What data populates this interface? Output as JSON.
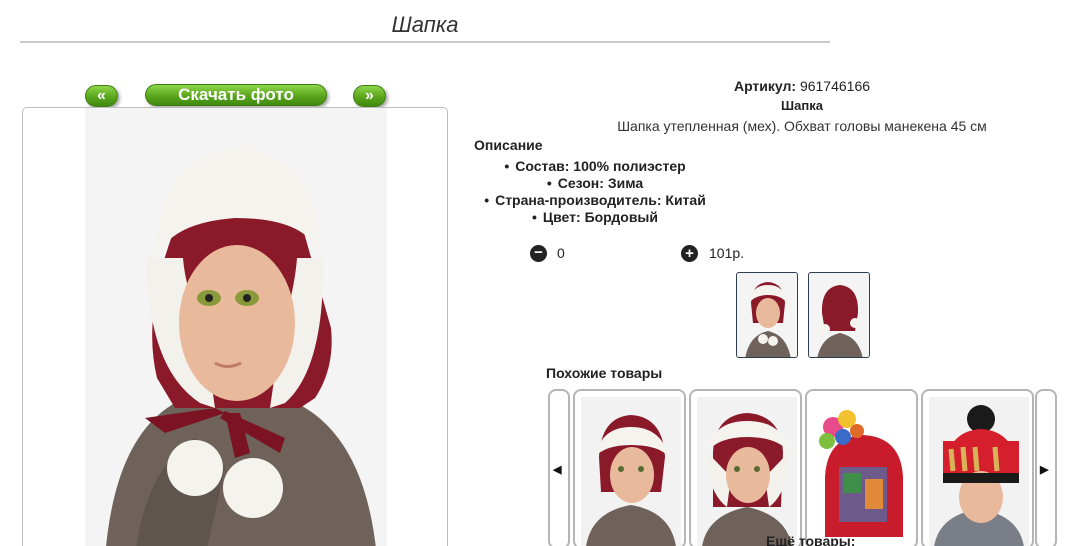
{
  "page": {
    "title": "Шапка"
  },
  "gallery": {
    "prev_label": "«",
    "download_label": "Скачать фото",
    "next_label": "»"
  },
  "product": {
    "sku_label": "Артикул:",
    "sku_value": "961746166",
    "name": "Шапка",
    "description": "Шапка утепленная (мех). Обхват головы манекена 45 см",
    "description_heading": "Описание",
    "specs": [
      "Состав: 100% полиэстер",
      "Сезон: Зима",
      "Страна-производитель: Китай",
      "Цвет: Бордовый"
    ]
  },
  "cart": {
    "minus_icon": "−",
    "quantity": "0",
    "plus_icon": "+",
    "price": "101р."
  },
  "similar": {
    "heading": "Похожие товары",
    "left_arrow": "◀",
    "right_arrow": "▶"
  },
  "more": {
    "heading": "Ещё товары:"
  },
  "colors": {
    "accent_green": "#5aa51c",
    "hat_burgundy": "#8a1a2a"
  }
}
